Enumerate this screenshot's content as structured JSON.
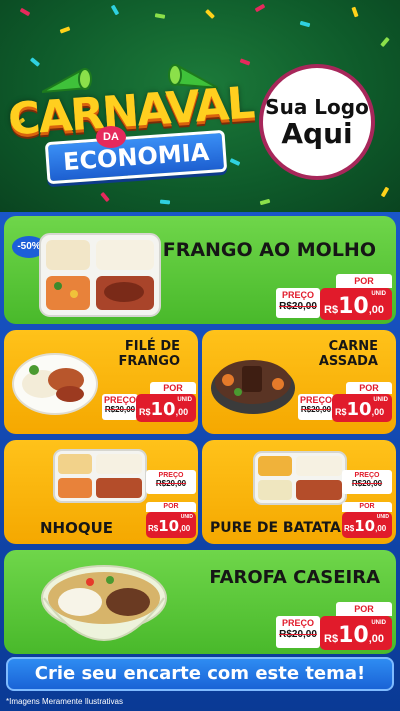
{
  "header": {
    "title_main": "CARNAVAL",
    "title_da": "DA",
    "title_sub": "ECONOMIA",
    "logo_line1": "Sua Logo",
    "logo_line2": "Aqui"
  },
  "products": [
    {
      "name": "FRANGO AO MOLHO",
      "badge": "-50%",
      "preco_label": "PREÇO",
      "old_price": "R$20,00",
      "por_label": "POR",
      "currency": "R$",
      "price_int": "10",
      "price_dec": ",00",
      "unit": "UNID"
    },
    {
      "name_l1": "FILÉ DE",
      "name_l2": "FRANGO",
      "preco_label": "PREÇO",
      "old_price": "R$20,00",
      "por_label": "POR",
      "currency": "R$",
      "price_int": "10",
      "price_dec": ",00",
      "unit": "UNID"
    },
    {
      "name_l1": "CARNE",
      "name_l2": "ASSADA",
      "preco_label": "PREÇO",
      "old_price": "R$20,00",
      "por_label": "POR",
      "currency": "R$",
      "price_int": "10",
      "price_dec": ",00",
      "unit": "UNID"
    },
    {
      "name": "NHOQUE",
      "preco_label": "PREÇO",
      "old_price": "R$20,00",
      "por_label": "POR",
      "currency": "R$",
      "price_int": "10",
      "price_dec": ",00",
      "unit": "UNID"
    },
    {
      "name": "PURE DE BATATA",
      "preco_label": "PREÇO",
      "old_price": "R$20,00",
      "por_label": "POR",
      "currency": "R$",
      "price_int": "10",
      "price_dec": ",00",
      "unit": "UNID"
    },
    {
      "name": "FAROFA CASEIRA",
      "preco_label": "PREÇO",
      "old_price": "R$20,00",
      "por_label": "POR",
      "currency": "R$",
      "price_int": "10",
      "price_dec": ",00",
      "unit": "UNID"
    }
  ],
  "cta": "Crie seu encarte com este tema!",
  "footnote": "*Imagens Meramente Ilustrativas",
  "colors": {
    "green_card": "#5cc83a",
    "yellow_card": "#ffbb12",
    "price_red": "#e11b2b",
    "background_blue": "#0b3f8c"
  }
}
